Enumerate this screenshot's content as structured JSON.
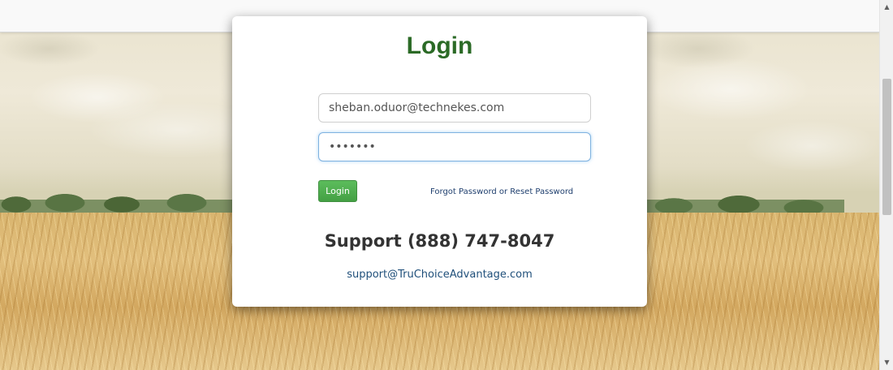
{
  "login": {
    "title": "Login",
    "email_value": "sheban.oduor@technekes.com",
    "password_value": "•••••••",
    "login_button": "Login",
    "forgot_link": "Forgot Password or Reset Password"
  },
  "support": {
    "phone_text": "Support (888) 747-8047",
    "email": "support@TruChoiceAdvantage.com"
  },
  "scrollbar": {
    "up_icon": "▲",
    "down_icon": "▼"
  }
}
